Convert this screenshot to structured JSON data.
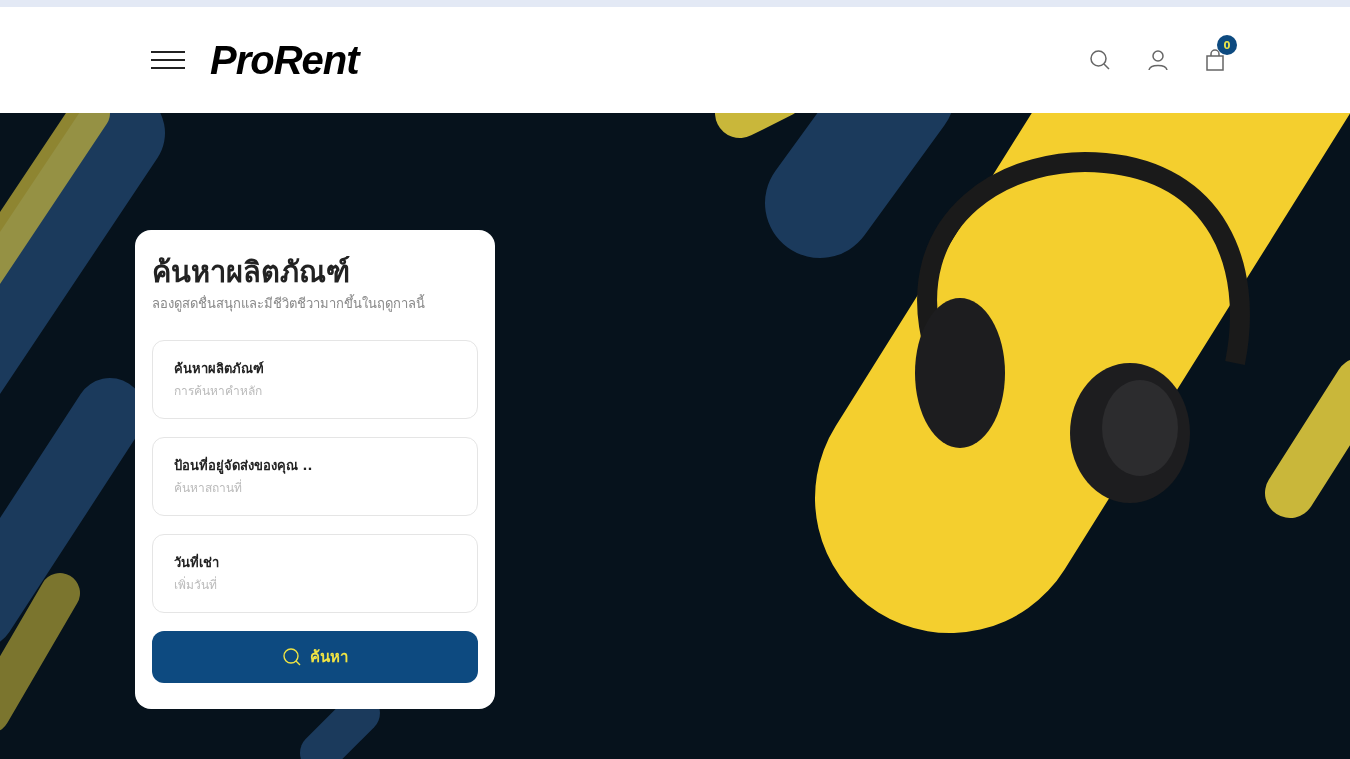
{
  "header": {
    "logo": "ProRent",
    "cart_count": "0"
  },
  "search_card": {
    "title": "ค้นหาผลิตภัณฑ์",
    "subtitle": "ลองดูสดชื่นสนุกและมีชีวิตชีวามากขึ้นในฤดูกาลนี้",
    "fields": [
      {
        "label": "ค้นหาผลิตภัณฑ์",
        "placeholder": "การค้นหาคำหลัก"
      },
      {
        "label": "ป้อนที่อยู่จัดส่งของคุณ ..",
        "placeholder": "ค้นหาสถานที่"
      },
      {
        "label": "วันที่เช่า",
        "placeholder": "เพิ่มวันที่"
      }
    ],
    "button": "ค้นหา"
  }
}
